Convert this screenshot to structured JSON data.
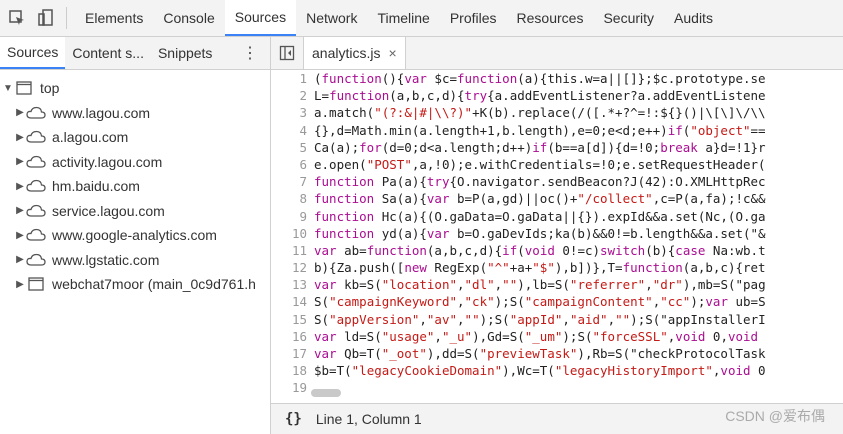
{
  "toolbar": {
    "icons": [
      "inspect-icon",
      "device-icon"
    ],
    "tabs": [
      "Elements",
      "Console",
      "Sources",
      "Network",
      "Timeline",
      "Profiles",
      "Resources",
      "Security",
      "Audits"
    ],
    "active_tab": "Sources"
  },
  "navigator": {
    "tabs": [
      "Sources",
      "Content s...",
      "Snippets"
    ],
    "active_tab": "Sources",
    "more_icon": "kebab-icon",
    "tree": [
      {
        "label": "top",
        "type": "frame",
        "expanded": true,
        "indent": 0
      },
      {
        "label": "www.lagou.com",
        "type": "cloud",
        "indent": 1
      },
      {
        "label": "a.lagou.com",
        "type": "cloud",
        "indent": 1
      },
      {
        "label": "activity.lagou.com",
        "type": "cloud",
        "indent": 1
      },
      {
        "label": "hm.baidu.com",
        "type": "cloud",
        "indent": 1
      },
      {
        "label": "service.lagou.com",
        "type": "cloud",
        "indent": 1
      },
      {
        "label": "www.google-analytics.com",
        "type": "cloud",
        "indent": 1
      },
      {
        "label": "www.lgstatic.com",
        "type": "cloud",
        "indent": 1
      },
      {
        "label": "webchat7moor (main_0c9d761.h",
        "type": "frame",
        "indent": 1
      }
    ]
  },
  "editor": {
    "file_tab": "analytics.js",
    "close_label": "×",
    "lines": [
      "(function(){var $c=function(a){this.w=a||[]};$c.prototype.se",
      "L=function(a,b,c,d){try{a.addEventListener?a.addEventListene",
      "a.match(\"(?:&|#|\\\\?)\"+K(b).replace(/([.*+?^=!:${}()|\\[\\]\\/\\\\",
      "{},d=Math.min(a.length+1,b.length),e=0;e<d;e++)if(\"object\"==",
      "Ca(a);for(d=0;d<a.length;d++)if(b==a[d]){d=!0;break a}d=!1}r",
      "e.open(\"POST\",a,!0);e.withCredentials=!0;e.setRequestHeader(",
      "function Pa(a){try{O.navigator.sendBeacon?J(42):O.XMLHttpRec",
      "function Sa(a){var b=P(a,gd)||oc()+\"/collect\",c=P(a,fa);!c&&",
      "function Hc(a){(O.gaData=O.gaData||{}).expId&&a.set(Nc,(O.ga",
      "function yd(a){var b=O.gaDevIds;ka(b)&&0!=b.length&&a.set(\"&",
      "var ab=function(a,b,c,d){if(void 0!=c)switch(b){case Na:wb.t",
      "b){Za.push([new RegExp(\"^\"+a+\"$\"),b])},T=function(a,b,c){ret",
      "var kb=S(\"location\",\"dl\",\"\"),lb=S(\"referrer\",\"dr\"),mb=S(\"pag",
      "S(\"campaignKeyword\",\"ck\");S(\"campaignContent\",\"cc\");var ub=S",
      "S(\"appVersion\",\"av\",\"\");S(\"appId\",\"aid\",\"\");S(\"appInstallerI",
      "var ld=S(\"usage\",\"_u\"),Gd=S(\"_um\");S(\"forceSSL\",void 0,void ",
      "var Qb=T(\"_oot\"),dd=S(\"previewTask\"),Rb=S(\"checkProtocolTask",
      "$b=T(\"legacyCookieDomain\"),Wc=T(\"legacyHistoryImport\",void 0",
      ""
    ]
  },
  "status": {
    "braces": "{}",
    "position": "Line 1, Column 1"
  },
  "watermark": "CSDN @爱布偶",
  "colors": {
    "keyword": "#aa0d91",
    "string": "#c41a16",
    "accent": "#3b82f6"
  }
}
